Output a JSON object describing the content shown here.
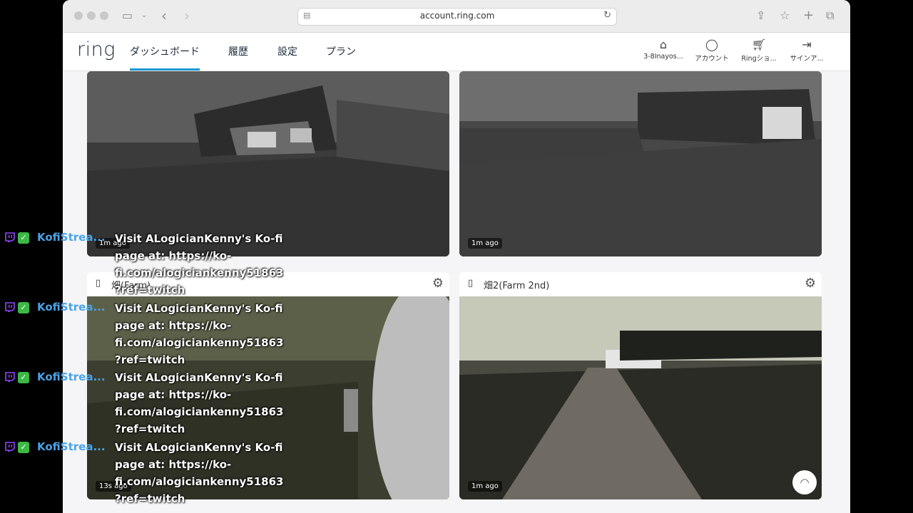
{
  "browser": {
    "url": "account.ring.com"
  },
  "nav": {
    "logo": "ring",
    "links": [
      "ダッシュボード",
      "履歴",
      "設定",
      "プラン"
    ],
    "right": [
      {
        "label": "3-8Inayos...",
        "icon": "home-icon"
      },
      {
        "label": "アカウント",
        "icon": "account-icon"
      },
      {
        "label": "Ringショ...",
        "icon": "cart-icon"
      },
      {
        "label": "サインア...",
        "icon": "sign-out-icon"
      }
    ]
  },
  "cameras": [
    {
      "name": "",
      "ago": "1m ago"
    },
    {
      "name": "",
      "ago": "1m ago"
    },
    {
      "name": "畑(Farm)",
      "ago": "13s ago"
    },
    {
      "name": "畑2(Farm 2nd)",
      "ago": "1m ago"
    }
  ],
  "overlay": {
    "name": "KofiStrea...",
    "message": "Visit ALogicianKenny's Ko-fi\npage at: https://ko-\nfi.com/alogiciankenny51863\n?ref=twitch",
    "colors": {
      "name": "#48a3e8",
      "twitch": "#9146ff",
      "kofi_badge": "#3cb944"
    }
  }
}
